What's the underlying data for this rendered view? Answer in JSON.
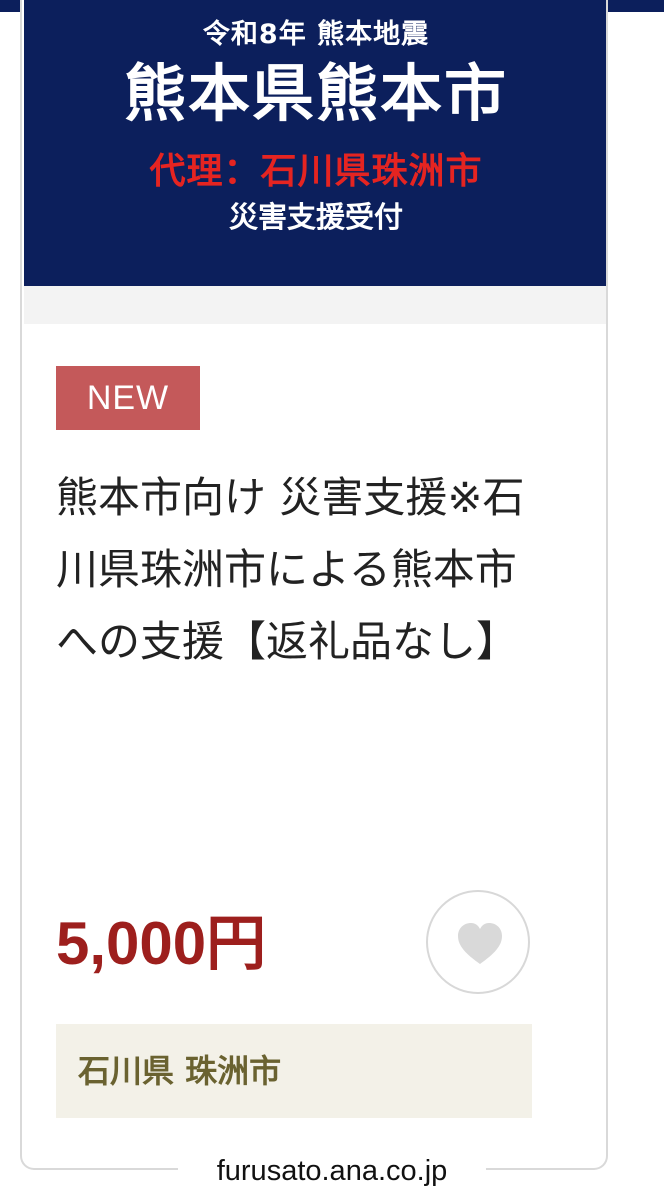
{
  "banner": {
    "line1": "令和8年 熊本地震",
    "title": "熊本県熊本市",
    "proxy": "代理：石川県珠洲市",
    "reception": "災害支援受付"
  },
  "item": {
    "badge": "NEW",
    "title": "熊本市向け 災害支援※石川県珠洲市による熊本市への支援【返礼品なし】",
    "price": "5,000円",
    "municipality": "石川県 珠洲市"
  },
  "favorite": {
    "icon": "heart-icon"
  },
  "site": {
    "url": "furusato.ana.co.jp"
  },
  "colors": {
    "banner_bg": "#0c1f5c",
    "proxy_text": "#e52421",
    "badge_bg": "#c4595a",
    "price_text": "#9d1f1d",
    "municipality_bg": "#f3f1e8",
    "municipality_text": "#6a6230"
  }
}
